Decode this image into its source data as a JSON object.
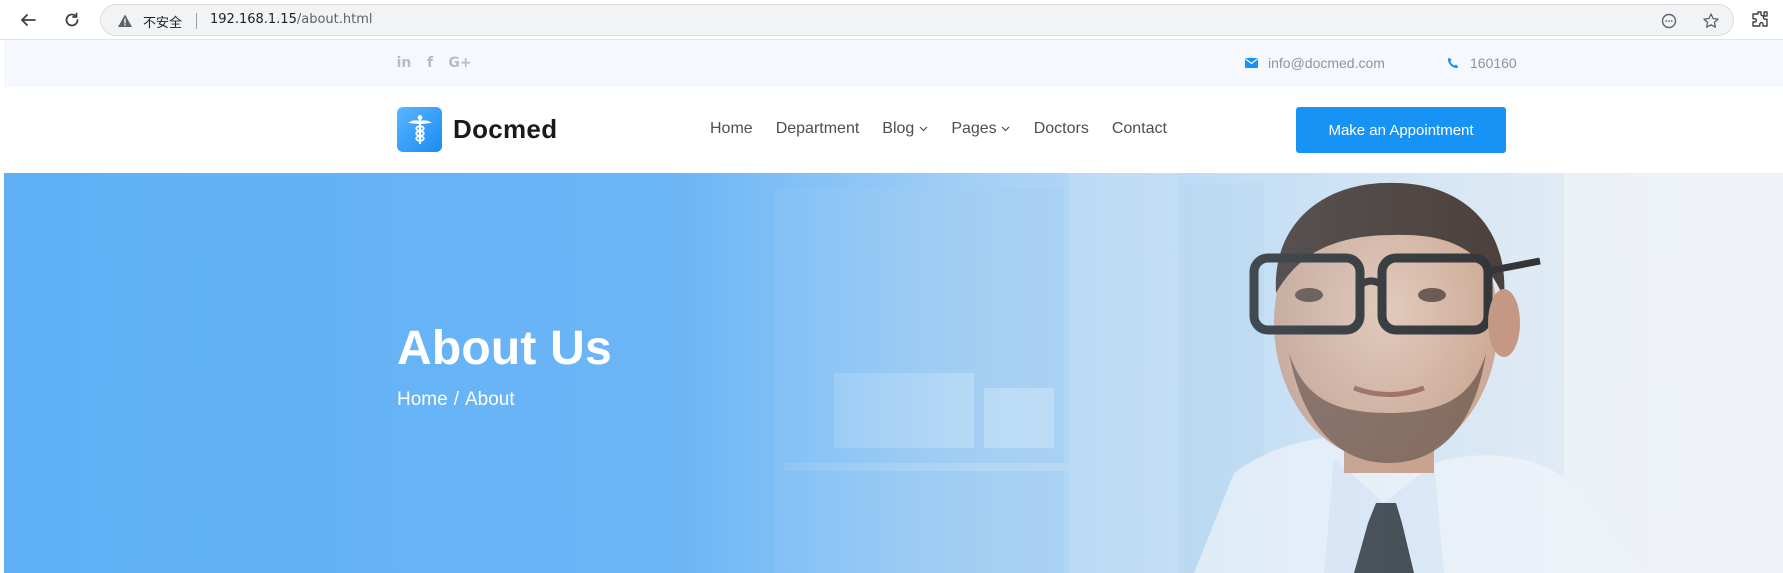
{
  "browser": {
    "insecure_label": "不安全",
    "url_host": "192.168.1.15",
    "url_path": "/about.html",
    "icons": [
      "back-arrow-icon",
      "reload-icon",
      "warning-icon",
      "reader-mode-icon",
      "star-icon",
      "extensions-icon"
    ]
  },
  "topbar": {
    "social": [
      {
        "name": "linkedin",
        "glyph": "in"
      },
      {
        "name": "facebook",
        "glyph": "f"
      },
      {
        "name": "google-plus",
        "glyph": "G+"
      }
    ],
    "email": "info@docmed.com",
    "phone": "160160",
    "accent": "#1693f5"
  },
  "navbar": {
    "brand": "Docmed",
    "menu": [
      {
        "label": "Home",
        "dropdown": false
      },
      {
        "label": "Department",
        "dropdown": false
      },
      {
        "label": "Blog",
        "dropdown": true
      },
      {
        "label": "Pages",
        "dropdown": true
      },
      {
        "label": "Doctors",
        "dropdown": false
      },
      {
        "label": "Contact",
        "dropdown": false
      }
    ],
    "cta": "Make an Appointment"
  },
  "hero": {
    "title": "About Us",
    "breadcrumb_home": "Home",
    "breadcrumb_sep": "/",
    "breadcrumb_current": "About",
    "overlay_color": "#5fb0f5"
  }
}
